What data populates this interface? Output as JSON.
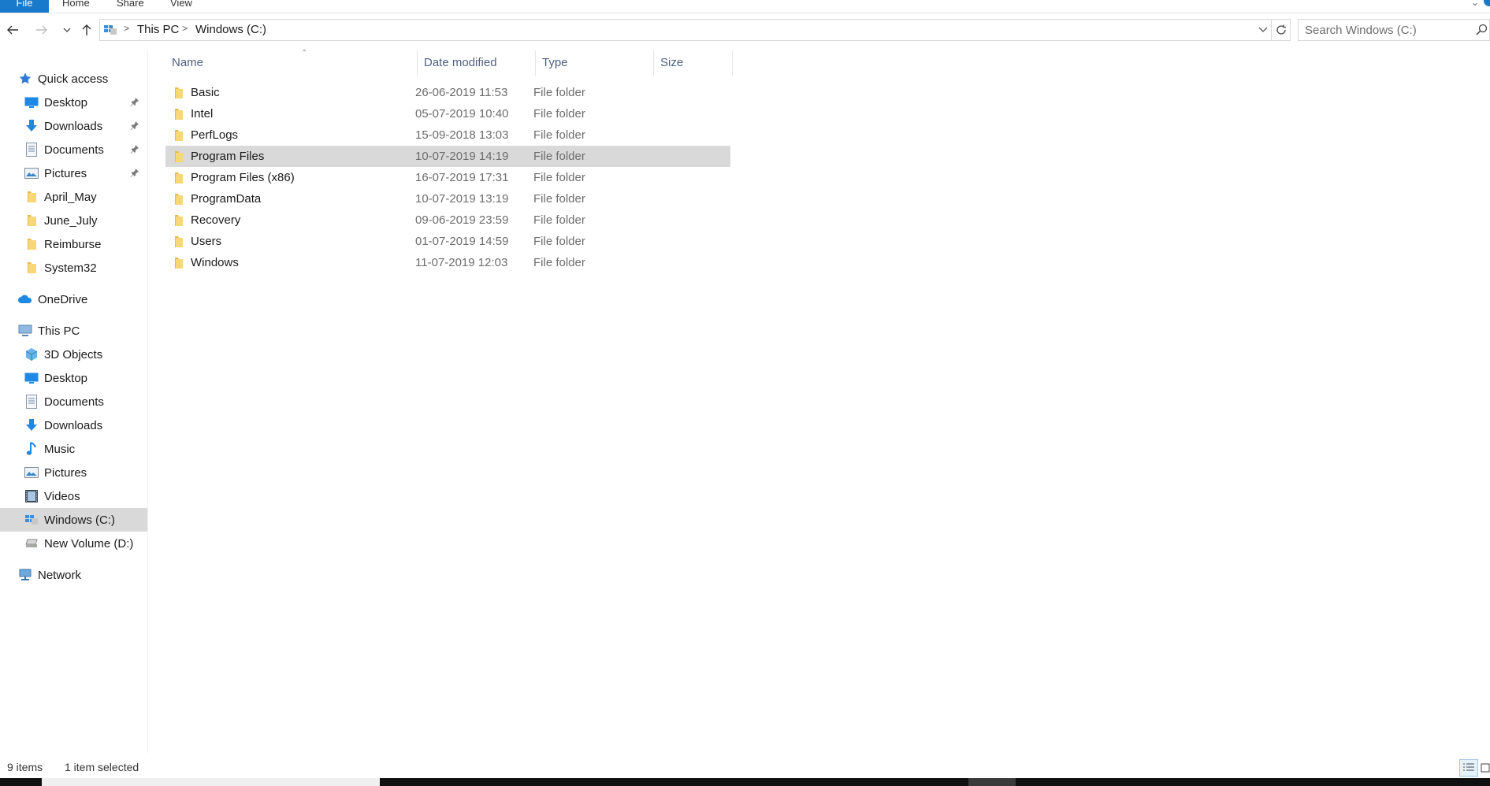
{
  "window": {
    "title": "Windows (C:)"
  },
  "ribbon": {
    "tabs": [
      {
        "label": "File"
      },
      {
        "label": "Home"
      },
      {
        "label": "Share"
      },
      {
        "label": "View"
      }
    ]
  },
  "address": {
    "crumbs": [
      "This PC",
      "Windows (C:)"
    ]
  },
  "search": {
    "placeholder": "Search Windows (C:)"
  },
  "nav": {
    "quick_access": "Quick access",
    "quick_items": [
      {
        "label": "Desktop",
        "icon": "desktop-icon",
        "pinned": true
      },
      {
        "label": "Downloads",
        "icon": "downloads-icon",
        "pinned": true
      },
      {
        "label": "Documents",
        "icon": "documents-icon",
        "pinned": true
      },
      {
        "label": "Pictures",
        "icon": "pictures-icon",
        "pinned": true
      },
      {
        "label": "April_May",
        "icon": "folder-icon",
        "pinned": false
      },
      {
        "label": "June_July",
        "icon": "folder-icon",
        "pinned": false
      },
      {
        "label": "Reimburse",
        "icon": "folder-icon",
        "pinned": false
      },
      {
        "label": "System32",
        "icon": "folder-icon",
        "pinned": false
      }
    ],
    "onedrive": "OneDrive",
    "this_pc": "This PC",
    "pc_items": [
      {
        "label": "3D Objects",
        "icon": "3d-objects-icon"
      },
      {
        "label": "Desktop",
        "icon": "desktop-icon"
      },
      {
        "label": "Documents",
        "icon": "documents-icon"
      },
      {
        "label": "Downloads",
        "icon": "downloads-icon"
      },
      {
        "label": "Music",
        "icon": "music-icon"
      },
      {
        "label": "Pictures",
        "icon": "pictures-icon"
      },
      {
        "label": "Videos",
        "icon": "videos-icon"
      },
      {
        "label": "Windows (C:)",
        "icon": "windows-drive-icon",
        "selected": true
      },
      {
        "label": "New Volume (D:)",
        "icon": "drive-icon"
      }
    ],
    "network": "Network"
  },
  "columns": {
    "name": "Name",
    "date": "Date modified",
    "type": "Type",
    "size": "Size"
  },
  "files": [
    {
      "name": "Basic",
      "date": "26-06-2019 11:53",
      "type": "File folder",
      "size": ""
    },
    {
      "name": "Intel",
      "date": "05-07-2019 10:40",
      "type": "File folder",
      "size": ""
    },
    {
      "name": "PerfLogs",
      "date": "15-09-2018 13:03",
      "type": "File folder",
      "size": ""
    },
    {
      "name": "Program Files",
      "date": "10-07-2019 14:19",
      "type": "File folder",
      "size": "",
      "selected": true
    },
    {
      "name": "Program Files (x86)",
      "date": "16-07-2019 17:31",
      "type": "File folder",
      "size": ""
    },
    {
      "name": "ProgramData",
      "date": "10-07-2019 13:19",
      "type": "File folder",
      "size": ""
    },
    {
      "name": "Recovery",
      "date": "09-06-2019 23:59",
      "type": "File folder",
      "size": ""
    },
    {
      "name": "Users",
      "date": "01-07-2019 14:59",
      "type": "File folder",
      "size": ""
    },
    {
      "name": "Windows",
      "date": "11-07-2019 12:03",
      "type": "File folder",
      "size": ""
    }
  ],
  "status": {
    "item_count": "9 items",
    "selection": "1 item selected"
  },
  "colors": {
    "accent": "#1979ca",
    "selection": "#d9d9d9",
    "folder": "#f8d775",
    "header_text": "#4d6082"
  }
}
